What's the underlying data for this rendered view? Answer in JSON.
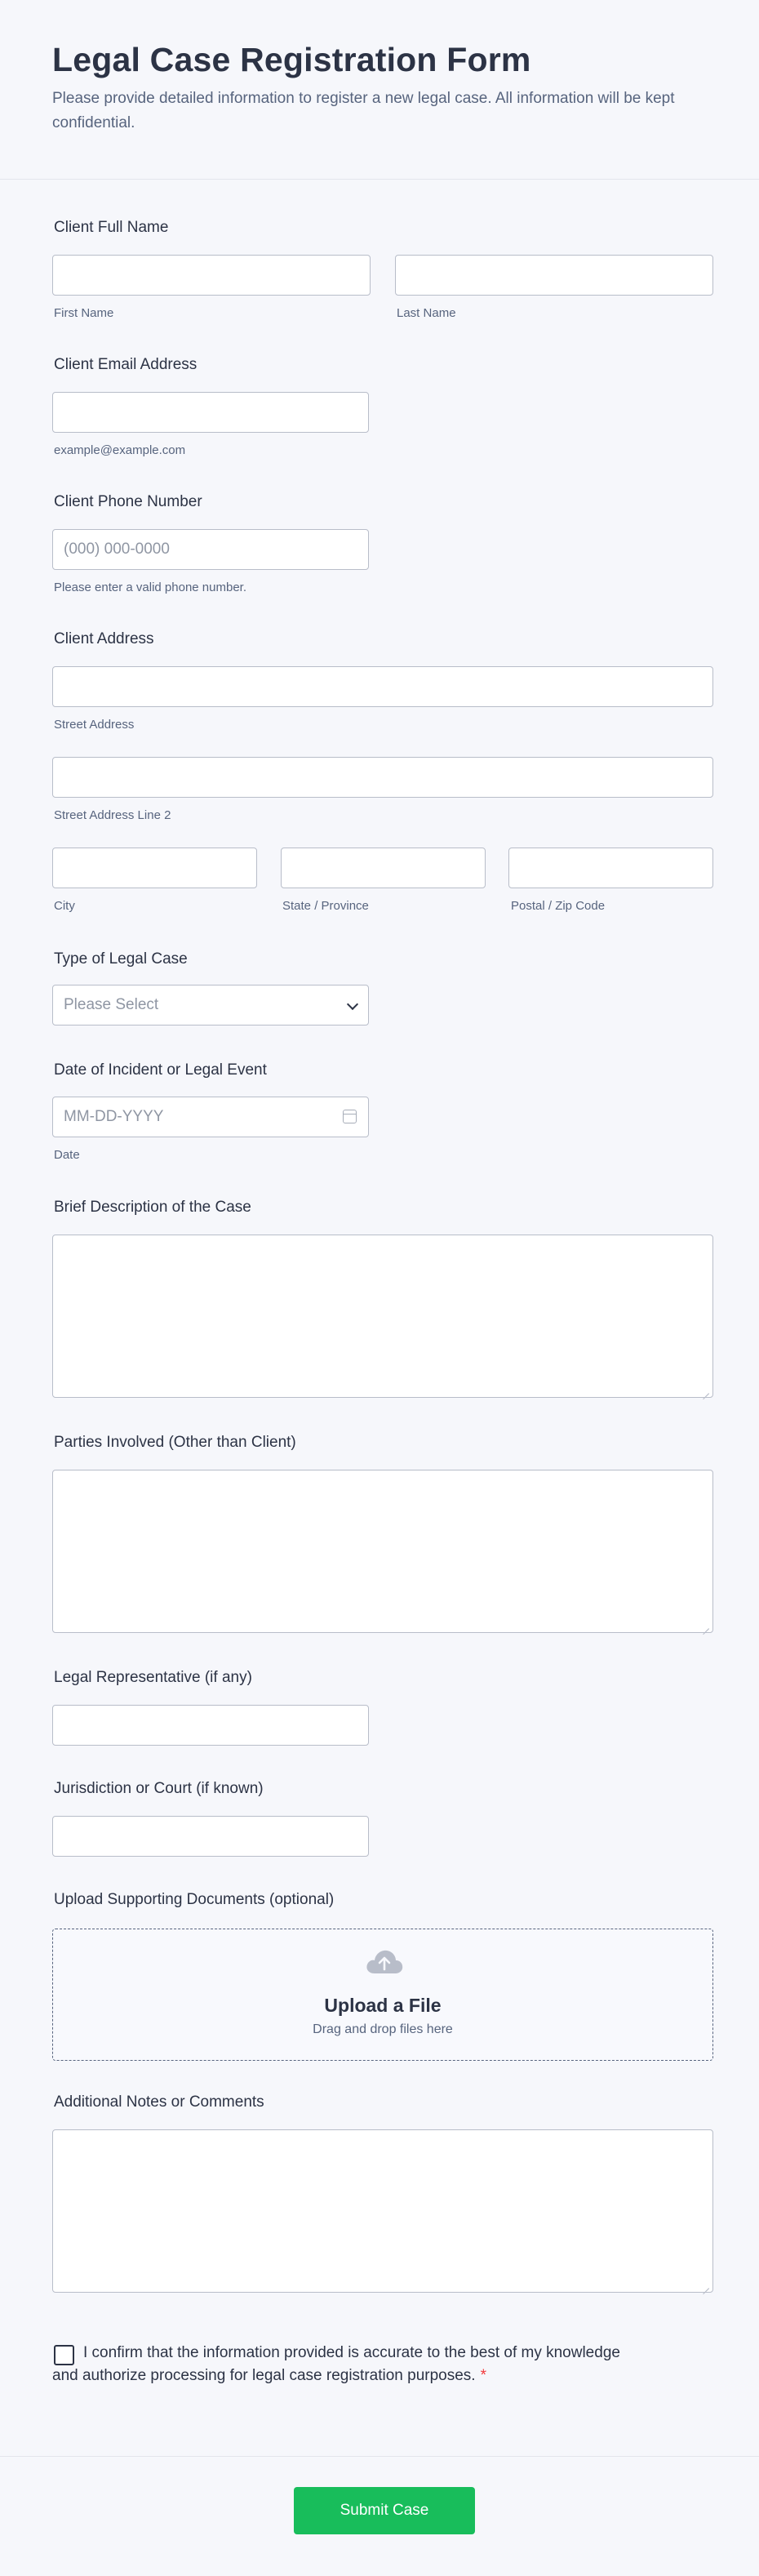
{
  "header": {
    "title": "Legal Case Registration Form",
    "subtitle": "Please provide detailed information to register a new legal case. All information will be kept confidential."
  },
  "fields": {
    "full_name": {
      "label": "Client Full Name",
      "first_sub": "First Name",
      "last_sub": "Last Name"
    },
    "email": {
      "label": "Client Email Address",
      "sub": "example@example.com"
    },
    "phone": {
      "label": "Client Phone Number",
      "placeholder": "(000) 000-0000",
      "sub": "Please enter a valid phone number."
    },
    "address": {
      "label": "Client Address",
      "street_sub": "Street Address",
      "street2_sub": "Street Address Line 2",
      "city_sub": "City",
      "state_sub": "State / Province",
      "zip_sub": "Postal / Zip Code"
    },
    "case_type": {
      "label": "Type of Legal Case",
      "placeholder": "Please Select"
    },
    "date": {
      "label": "Date of Incident or Legal Event",
      "placeholder": "MM-DD-YYYY",
      "sub": "Date"
    },
    "description": {
      "label": "Brief Description of the Case"
    },
    "parties": {
      "label": "Parties Involved (Other than Client)"
    },
    "representative": {
      "label": "Legal Representative (if any)"
    },
    "jurisdiction": {
      "label": "Jurisdiction or Court (if known)"
    },
    "upload": {
      "label": "Upload Supporting Documents (optional)",
      "title": "Upload a File",
      "sub": "Drag and drop files here"
    },
    "notes": {
      "label": "Additional Notes or Comments"
    },
    "confirm": {
      "text": "I confirm that the information provided is accurate to the best of my knowledge and authorize processing for legal case registration purposes.",
      "required_mark": "*"
    }
  },
  "submit": {
    "label": "Submit Case"
  },
  "colors": {
    "accent": "#18bd5b",
    "text": "#2c3345",
    "muted": "#57647e",
    "border": "#b8bdc9",
    "required": "#f23a3c"
  },
  "icons": {
    "select": "chevron-down-icon",
    "date": "calendar-icon",
    "upload": "cloud-upload-icon",
    "resize": "resize-grip-icon"
  }
}
